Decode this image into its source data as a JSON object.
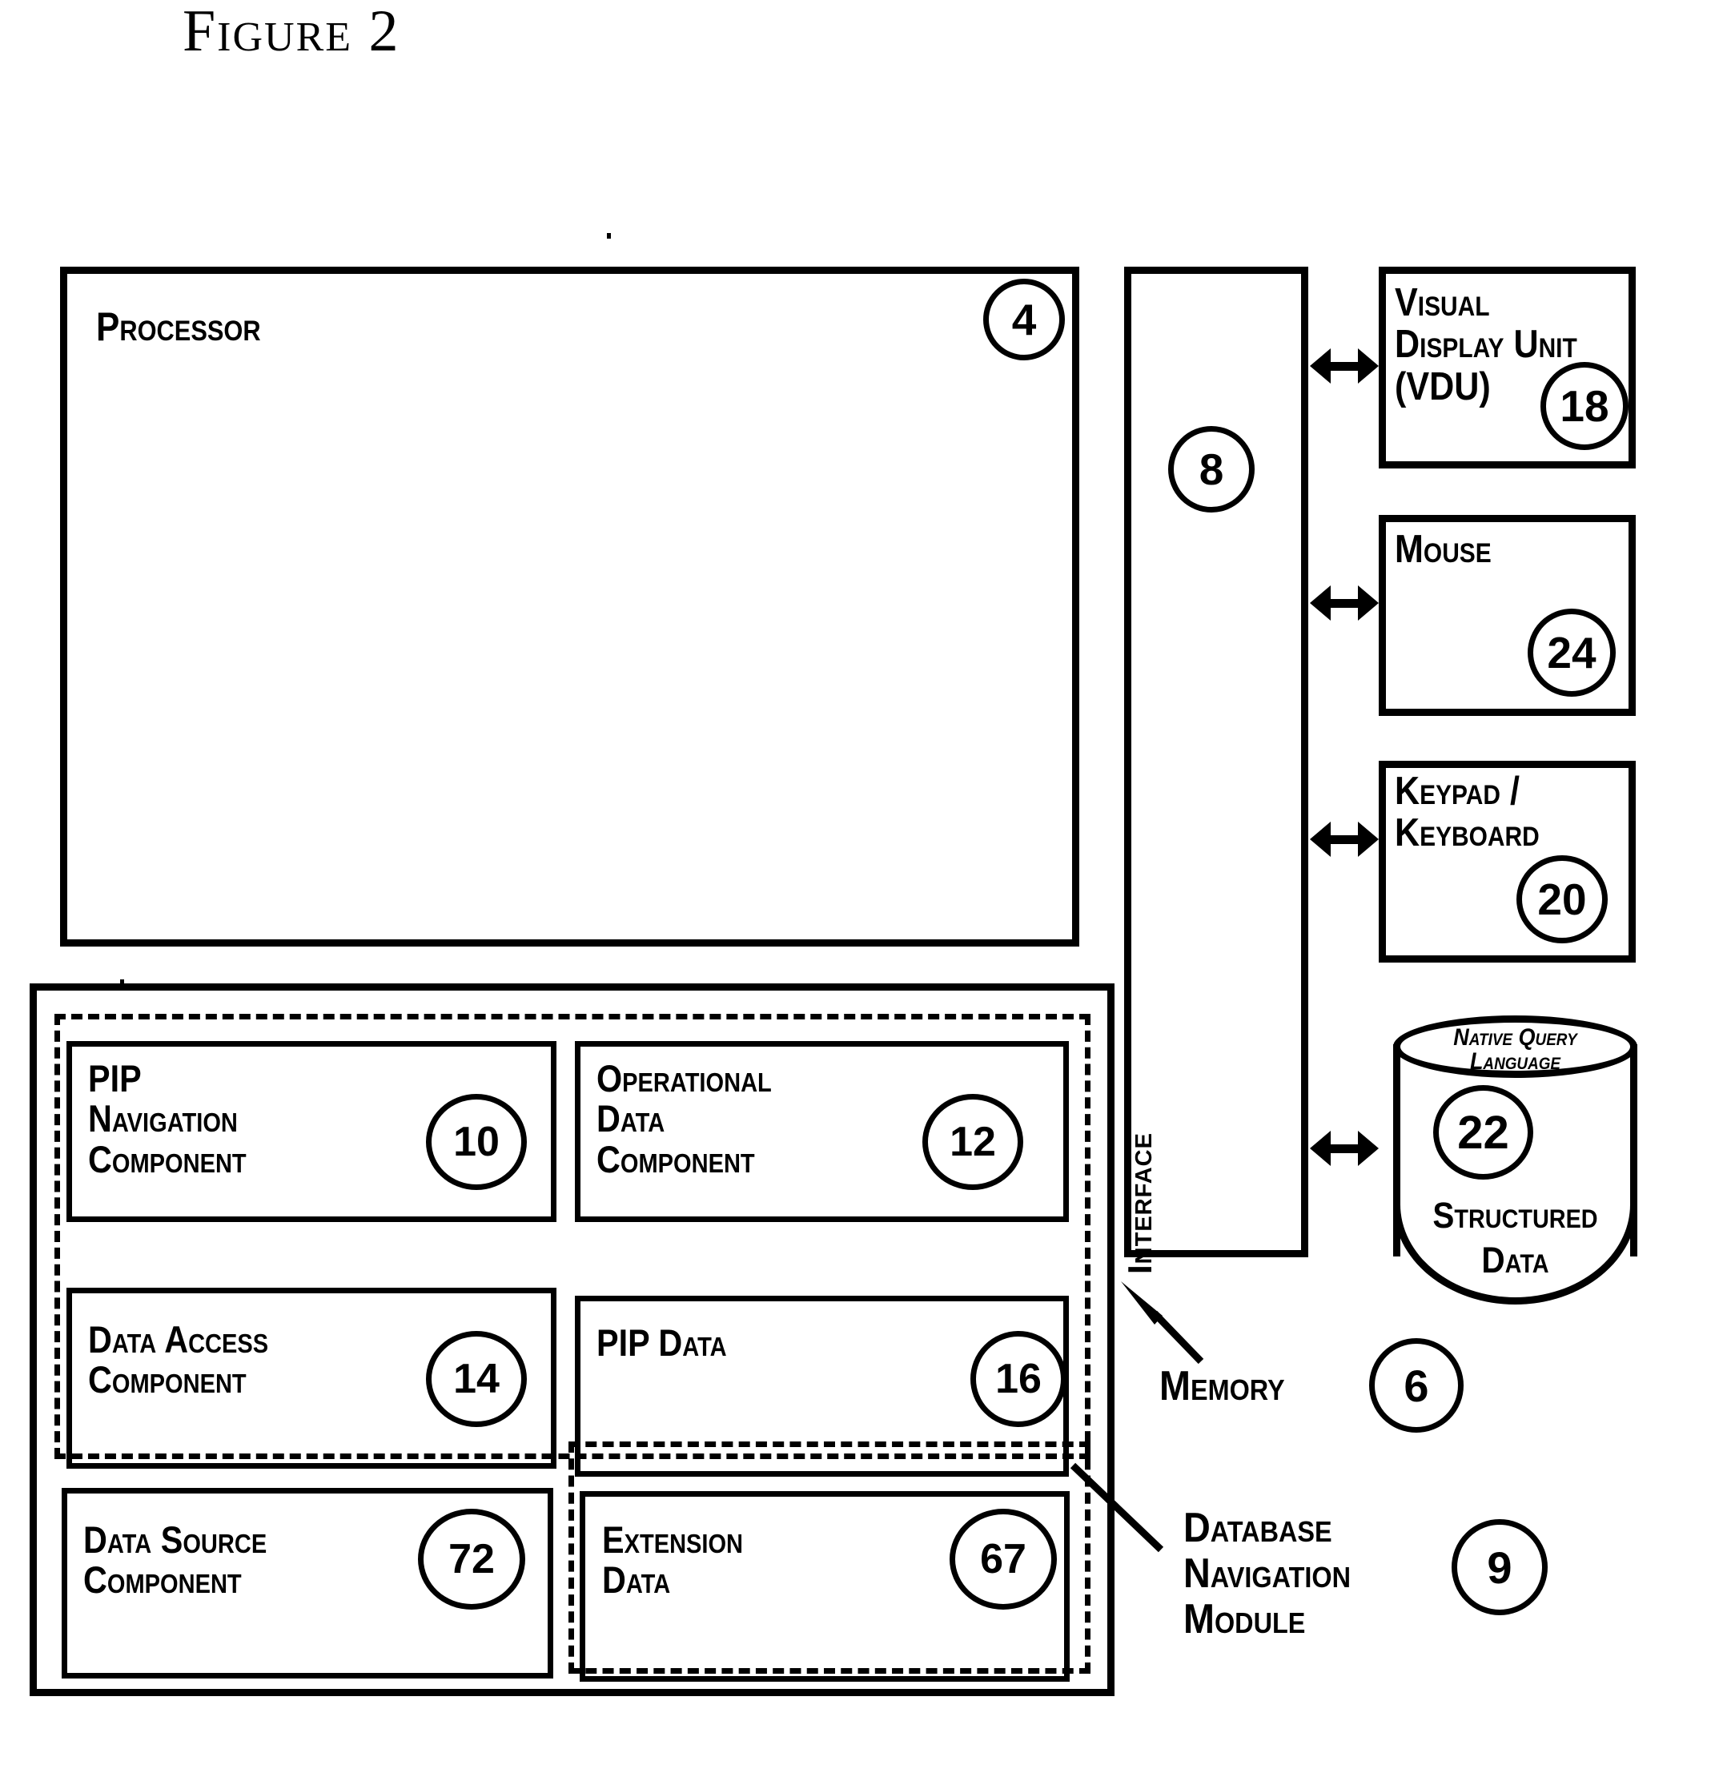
{
  "figure": {
    "title": "Figure 2"
  },
  "processor": {
    "label": "Processor",
    "ref": "4"
  },
  "interface": {
    "label": "Interface",
    "ref": "8"
  },
  "peripherals": [
    {
      "name": "visual-display-unit",
      "label": "Visual\nDisplay Unit\n(VDU)",
      "ref": "18"
    },
    {
      "name": "mouse",
      "label": "Mouse",
      "ref": "24"
    },
    {
      "name": "keypad-keyboard",
      "label": "Keypad /\nKeyboard",
      "ref": "20"
    }
  ],
  "database": {
    "top_label": "Native Query\nLanguage",
    "bottom_label": "Structured\nData",
    "ref": "22"
  },
  "memory": {
    "label": "Memory",
    "ref": "6"
  },
  "database_navigation_module": {
    "label": "Database\nNavigation\nModule",
    "ref": "9"
  },
  "components": [
    {
      "name": "pip-navigation-component",
      "label": "PIP\nNavigation\nComponent",
      "ref": "10"
    },
    {
      "name": "operational-data-component",
      "label": "Operational\nData\nComponent",
      "ref": "12"
    },
    {
      "name": "data-access-component",
      "label": "Data Access\nComponent",
      "ref": "14"
    },
    {
      "name": "pip-data",
      "label": "PIP Data",
      "ref": "16"
    },
    {
      "name": "data-source-component",
      "label": "Data Source\nComponent",
      "ref": "72"
    },
    {
      "name": "extension-data",
      "label": "Extension\nData",
      "ref": "67"
    }
  ],
  "colors": {
    "stroke": "#000000",
    "background": "#ffffff"
  }
}
